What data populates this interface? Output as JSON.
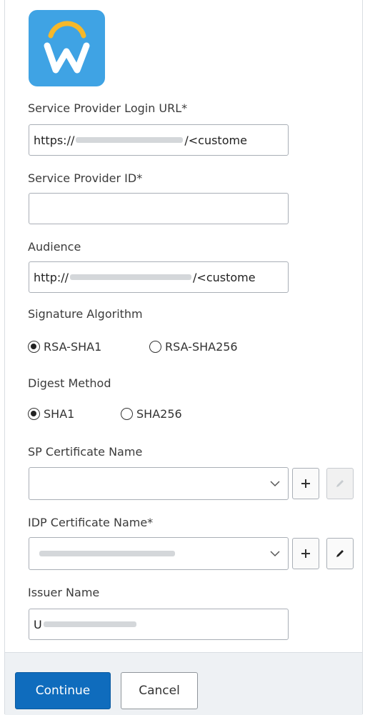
{
  "form": {
    "sp_login_url": {
      "label": "Service Provider Login URL*",
      "value_prefix": "https://",
      "value_suffix": "/<custome"
    },
    "sp_id": {
      "label": "Service Provider ID*",
      "value": ""
    },
    "audience": {
      "label": "Audience",
      "value_prefix": "http://",
      "value_suffix": "/<custome"
    },
    "signature_algorithm": {
      "label": "Signature Algorithm",
      "options": [
        "RSA-SHA1",
        "RSA-SHA256"
      ],
      "selected": "RSA-SHA1"
    },
    "digest_method": {
      "label": "Digest Method",
      "options": [
        "SHA1",
        "SHA256"
      ],
      "selected": "SHA1"
    },
    "sp_certificate": {
      "label": "SP Certificate Name",
      "value": ""
    },
    "idp_certificate": {
      "label": "IDP Certificate Name*"
    },
    "issuer_name": {
      "label": "Issuer Name",
      "value_prefix": "U"
    }
  },
  "footer": {
    "continue_label": "Continue",
    "cancel_label": "Cancel"
  },
  "colors": {
    "logo_bg": "#3fa3e4",
    "primary": "#0f6cbd"
  }
}
